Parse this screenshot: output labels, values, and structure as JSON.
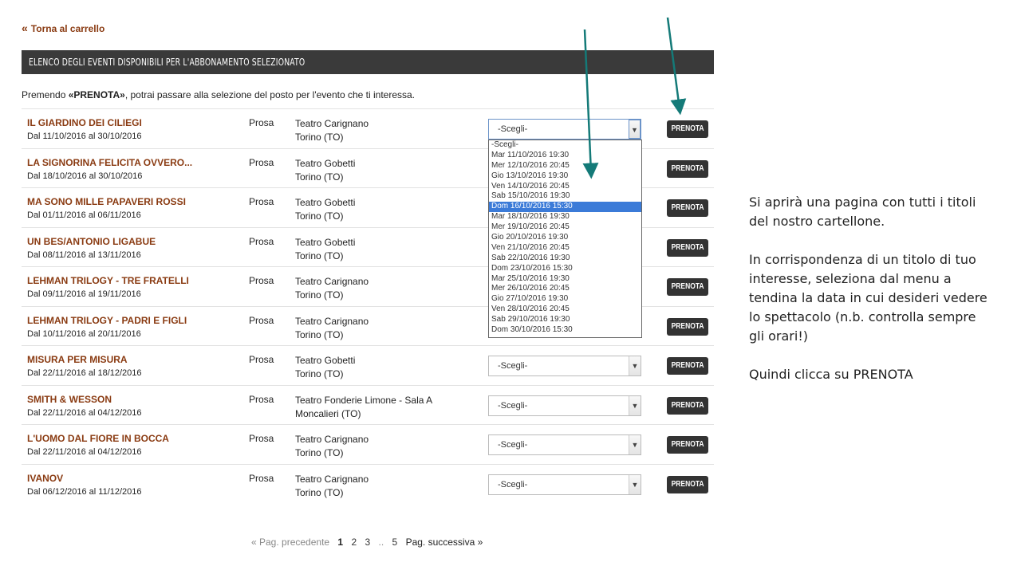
{
  "back_link": {
    "chev": "«",
    "label": "Torna al carrello"
  },
  "section_header": "ELENCO DEGLI EVENTI DISPONIBILI PER L'ABBONAMENTO SELEZIONATO",
  "intro": {
    "before": "Premendo ",
    "bold": "«PRENOTA»",
    "after": ", potrai passare alla selezione del posto per l'evento che ti interessa."
  },
  "events": [
    {
      "title": "IL GIARDINO DEI CILIEGI",
      "dates": "Dal 11/10/2016 al 30/10/2016",
      "genre": "Prosa",
      "venue": "Teatro Carignano",
      "city": "Torino (TO)",
      "select": "-Scegli-",
      "button": "PRENOTA"
    },
    {
      "title": "LA SIGNORINA FELICITA OVVERO...",
      "dates": "Dal 18/10/2016 al 30/10/2016",
      "genre": "Prosa",
      "venue": "Teatro Gobetti",
      "city": "Torino (TO)",
      "select": "-Scegli-",
      "button": "PRENOTA"
    },
    {
      "title": "MA SONO MILLE PAPAVERI ROSSI",
      "dates": "Dal 01/11/2016 al 06/11/2016",
      "genre": "Prosa",
      "venue": "Teatro Gobetti",
      "city": "Torino (TO)",
      "select": "-Scegli-",
      "button": "PRENOTA"
    },
    {
      "title": "UN BES/ANTONIO LIGABUE",
      "dates": "Dal 08/11/2016 al 13/11/2016",
      "genre": "Prosa",
      "venue": "Teatro Gobetti",
      "city": "Torino (TO)",
      "select": "-Scegli-",
      "button": "PRENOTA"
    },
    {
      "title": "LEHMAN TRILOGY - TRE FRATELLI",
      "dates": "Dal 09/11/2016 al 19/11/2016",
      "genre": "Prosa",
      "venue": "Teatro Carignano",
      "city": "Torino (TO)",
      "select": "-Scegli-",
      "button": "PRENOTA"
    },
    {
      "title": "LEHMAN TRILOGY - PADRI E FIGLI",
      "dates": "Dal 10/11/2016 al 20/11/2016",
      "genre": "Prosa",
      "venue": "Teatro Carignano",
      "city": "Torino (TO)",
      "select": "-Scegli-",
      "button": "PRENOTA"
    },
    {
      "title": "MISURA PER MISURA",
      "dates": "Dal 22/11/2016 al 18/12/2016",
      "genre": "Prosa",
      "venue": "Teatro Gobetti",
      "city": "Torino (TO)",
      "select": "-Scegli-",
      "button": "PRENOTA"
    },
    {
      "title": "SMITH & WESSON",
      "dates": "Dal 22/11/2016 al 04/12/2016",
      "genre": "Prosa",
      "venue": "Teatro Fonderie Limone - Sala A",
      "city": "Moncalieri (TO)",
      "select": "-Scegli-",
      "button": "PRENOTA"
    },
    {
      "title": "L'UOMO DAL FIORE IN BOCCA",
      "dates": "Dal 22/11/2016 al 04/12/2016",
      "genre": "Prosa",
      "venue": "Teatro Carignano",
      "city": "Torino (TO)",
      "select": "-Scegli-",
      "button": "PRENOTA"
    },
    {
      "title": "IVANOV",
      "dates": "Dal 06/12/2016 al 11/12/2016",
      "genre": "Prosa",
      "venue": "Teatro Carignano",
      "city": "Torino (TO)",
      "select": "-Scegli-",
      "button": "PRENOTA"
    }
  ],
  "dropdown_options": [
    "-Scegli-",
    "Mar 11/10/2016 19:30",
    "Mer 12/10/2016 20:45",
    "Gio 13/10/2016 19:30",
    "Ven 14/10/2016 20:45",
    "Sab 15/10/2016 19:30",
    "Dom 16/10/2016 15:30",
    "Mar 18/10/2016 19:30",
    "Mer 19/10/2016 20:45",
    "Gio 20/10/2016 19:30",
    "Ven 21/10/2016 20:45",
    "Sab 22/10/2016 19:30",
    "Dom 23/10/2016 15:30",
    "Mar 25/10/2016 19:30",
    "Mer 26/10/2016 20:45",
    "Gio 27/10/2016 19:30",
    "Ven 28/10/2016 20:45",
    "Sab 29/10/2016 19:30",
    "Dom 30/10/2016 15:30"
  ],
  "dropdown_highlighted": "Dom 16/10/2016 15:30",
  "pagination": {
    "prev": "« Pag. precedente",
    "pages": [
      "1",
      "2",
      "3"
    ],
    "current": "1",
    "ellipsis": "..",
    "last": "5",
    "next": "Pag. successiva »"
  },
  "side_text": {
    "p1": "Si aprirà una pagina  con tutti i titoli del nostro cartellone.",
    "p2": "In corrispondenza di un titolo di tuo interesse, seleziona dal menu a tendina la data in cui desideri vedere lo spettacolo (n.b. controlla sempre gli orari!)",
    "p3": "Quindi clicca su PRENOTA"
  },
  "colors": {
    "title": "#8a3b12",
    "header_bg": "#3a3a3a",
    "button_bg": "#333333",
    "highlight": "#3b7bd8",
    "annotation_arrow": "#147a78"
  }
}
